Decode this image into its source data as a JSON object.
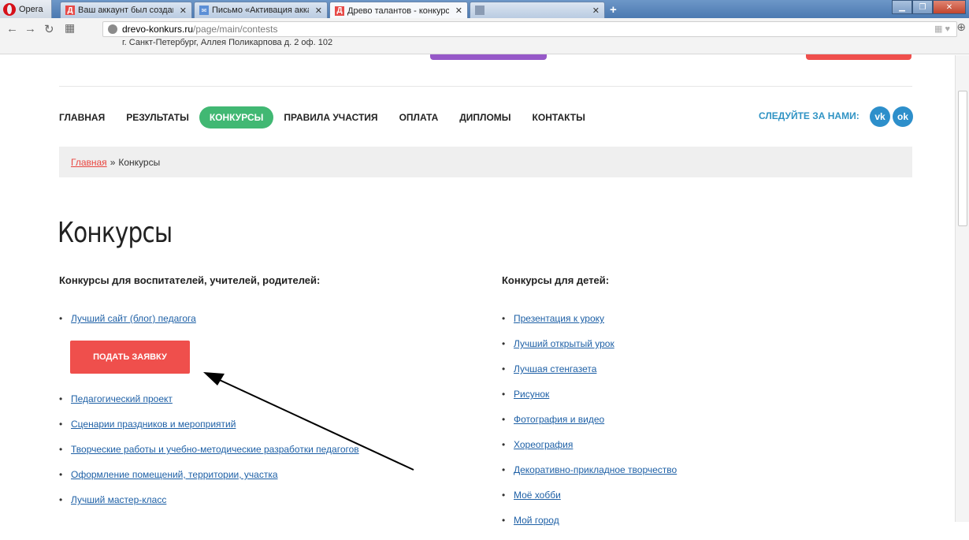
{
  "browser": {
    "opera_label": "Opera",
    "tabs": [
      {
        "title": "Ваш аккаунт был создан",
        "close": "✕"
      },
      {
        "title": "Письмо «Активация акка",
        "close": "✕"
      },
      {
        "title": "Древо талантов - конкурс",
        "close": "✕"
      },
      {
        "title": "",
        "close": "✕"
      }
    ],
    "new_tab": "+",
    "url_host": "drevo-konkurs.ru",
    "url_path": "/page/main/contests"
  },
  "header": {
    "address": "г. Санкт-Петербург, Аллея Поликарпова д. 2 оф. 102"
  },
  "nav": {
    "items": [
      "Главная",
      "Результаты",
      "Конкурсы",
      "Правила участия",
      "Оплата",
      "Дипломы",
      "Контакты"
    ],
    "active_index": 2,
    "follow_label": "Следуйте за нами:",
    "vk_label": "vk",
    "ok_label": "ok"
  },
  "breadcrumb": {
    "home": "Главная",
    "separator": "»",
    "current": "Конкурсы"
  },
  "page": {
    "title": "Конкурсы",
    "teachers_heading": "Конкурсы для воспитателей, учителей, родителей:",
    "kids_heading": "Конкурсы для детей:",
    "submit_label": "Подать заявку",
    "teachers_first": "Лучший сайт (блог) педагога",
    "teachers_rest": [
      "Педагогический проект",
      "Сценарии праздников и мероприятий",
      "Творческие работы и учебно-методические разработки педагогов",
      "Оформление помещений, территории, участка",
      "Лучший мастер-класс"
    ],
    "kids": [
      "Презентация к уроку",
      "Лучший открытый урок",
      "Лучшая стенгазета",
      "Рисунок",
      "Фотография и видео",
      "Хореография",
      "Декоративно-прикладное творчество",
      "Моё хобби",
      "Мой город"
    ]
  },
  "colors": {
    "accent_green": "#41b873",
    "accent_red": "#ef4f4c",
    "link_blue": "#1e60a6",
    "social_blue": "#2d8fcb"
  }
}
